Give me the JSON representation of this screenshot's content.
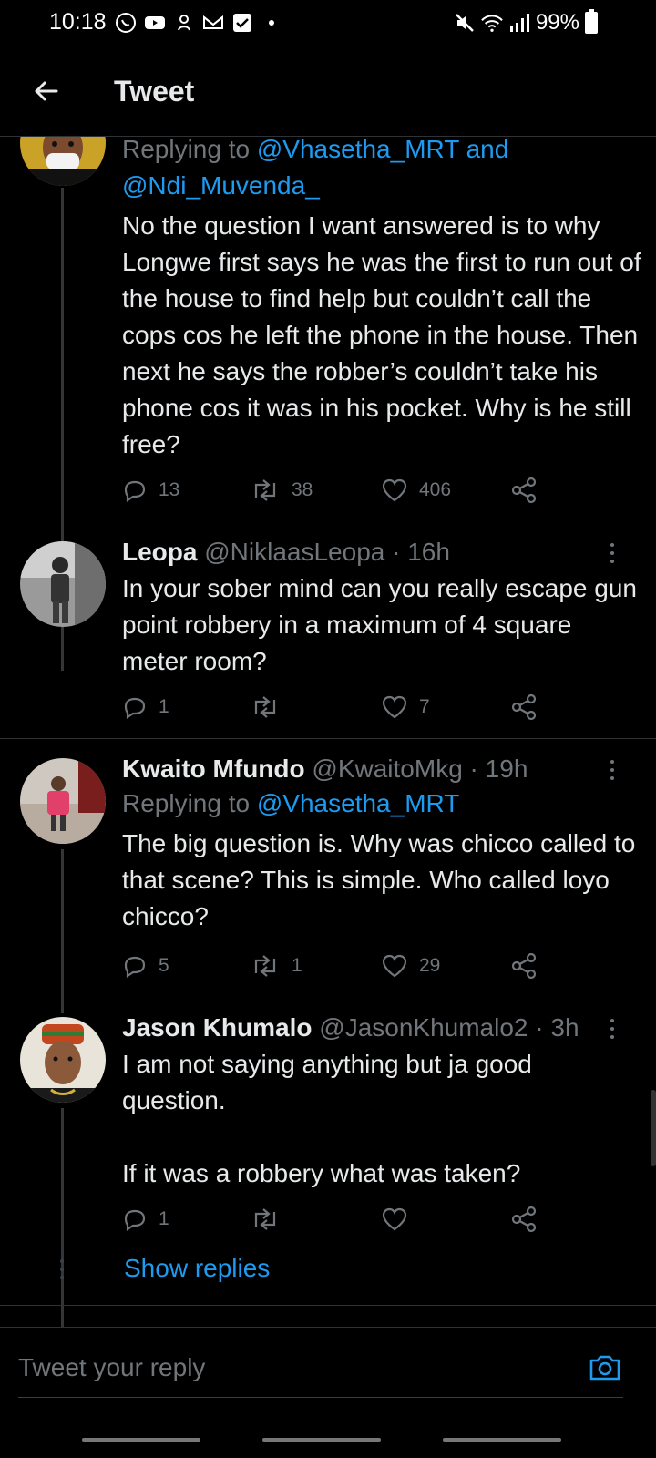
{
  "status_bar": {
    "time": "10:18",
    "battery": "99%",
    "left_icons": [
      "whatsapp-icon",
      "youtube-icon",
      "notification-icon",
      "gmail-icon",
      "checkbox-icon",
      "dot-icon"
    ],
    "right_icons": [
      "mute-icon",
      "wifi-icon",
      "signal-icon",
      "battery-icon"
    ]
  },
  "header": {
    "title": "Tweet"
  },
  "tweets": [
    {
      "reply_prefix": "Replying to ",
      "reply_mention_1": "@Vhasetha_MRT",
      "reply_join": " and",
      "reply_mention_2": "@Ndi_Muvenda_",
      "text": "No the question I want answered is to why Longwe first says he was the first to run out of the house to find help but couldn’t call the cops cos he left the phone in the house. Then next he says the robber’s couldn’t take his phone cos it was in his pocket. Why is he still free?",
      "replies": "13",
      "retweets": "38",
      "likes": "406"
    },
    {
      "name": "Leopa",
      "handle": "@NiklaasLeopa",
      "time": "16h",
      "text": "In your sober mind can you really escape gun point robbery in a maximum of 4 square meter room?",
      "replies": "1",
      "retweets": "",
      "likes": "7"
    },
    {
      "name": "Kwaito Mfundo",
      "handle": "@KwaitoMkg",
      "time": "19h",
      "reply_prefix": "Replying to ",
      "reply_mention_1": "@Vhasetha_MRT",
      "text": "The big question is. Why was chicco called to that scene? This is simple. Who called loyo chicco?",
      "replies": "5",
      "retweets": "1",
      "likes": "29"
    },
    {
      "name": "Jason Khumalo",
      "handle": "@JasonKhumalo2",
      "time": "3h",
      "text": "I am not saying anything but ja good question.\n\nIf it was a robbery what was taken?",
      "replies": "1",
      "retweets": "",
      "likes": ""
    }
  ],
  "meta_separator": " · ",
  "show_replies": "Show replies",
  "reply_bar": {
    "placeholder": "Tweet your reply"
  }
}
